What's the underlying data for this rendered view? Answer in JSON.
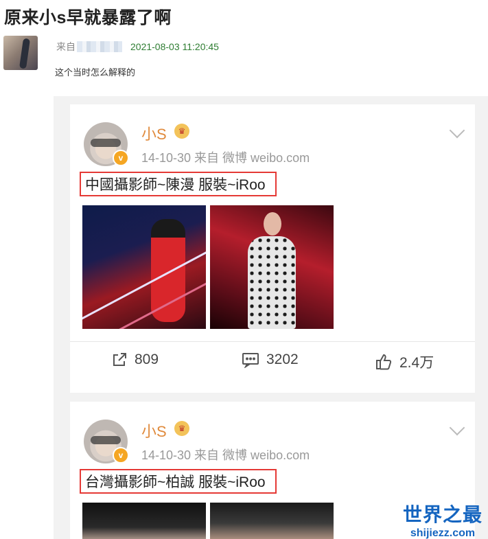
{
  "page": {
    "title": "原来小s早就暴露了啊",
    "from_label": "来自",
    "timestamp": "2021-08-03 11:20:45",
    "post_text": "这个当时怎么解释的"
  },
  "cards": [
    {
      "user_name": "小S",
      "meta": "14-10-30  来自 微博 weibo.com",
      "caption": "中國攝影師~陳漫 服裝~iRoo",
      "repost_count": "809",
      "comment_count": "3202",
      "like_count": "2.4万"
    },
    {
      "user_name": "小S",
      "meta": "14-10-30  来自 微博 weibo.com",
      "caption": "台灣攝影師~柏誠 服裝~iRoo"
    }
  ],
  "watermark": {
    "title": "世界之最",
    "url": "shijiezz.com"
  },
  "icons": [
    "share-icon",
    "comment-icon",
    "like-icon",
    "chevron-down-icon",
    "crown-icon",
    "verified-badge-icon"
  ],
  "colors": {
    "timestamp": "#2e7d32",
    "username": "#e08a3c",
    "highlight_border": "#e53935",
    "watermark": "#1565c0"
  }
}
